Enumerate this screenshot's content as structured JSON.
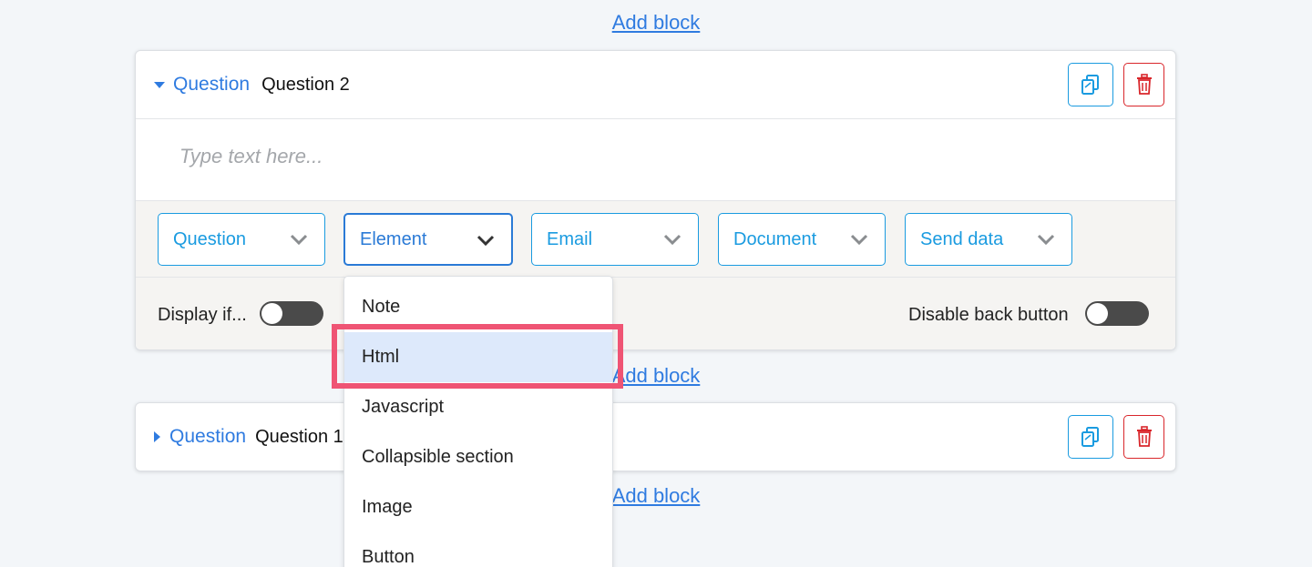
{
  "add_block_label": "Add block",
  "blocks": [
    {
      "type_label": "Question",
      "name": "Question 2",
      "text_placeholder": "Type text here...",
      "selects": [
        "Question",
        "Element",
        "Email",
        "Document",
        "Send data"
      ],
      "display_if_label": "Display if...",
      "disable_back_label": "Disable back button"
    },
    {
      "type_label": "Question",
      "name": "Question 1"
    }
  ],
  "element_menu": {
    "items": [
      "Note",
      "Html",
      "Javascript",
      "Collapsible section",
      "Image",
      "Button"
    ],
    "hovered": "Html"
  },
  "colors": {
    "accent_link": "#2f7be0",
    "select_border": "#1a9be0",
    "delete_red": "#d9262b",
    "highlight": "#ef5474",
    "hover_bg": "#dde9fb"
  },
  "icons": {
    "copy": "copy-icon",
    "delete": "trash-icon",
    "expanded": "caret-down-icon",
    "collapsed": "caret-right-icon",
    "select": "chevron-down-icon"
  }
}
